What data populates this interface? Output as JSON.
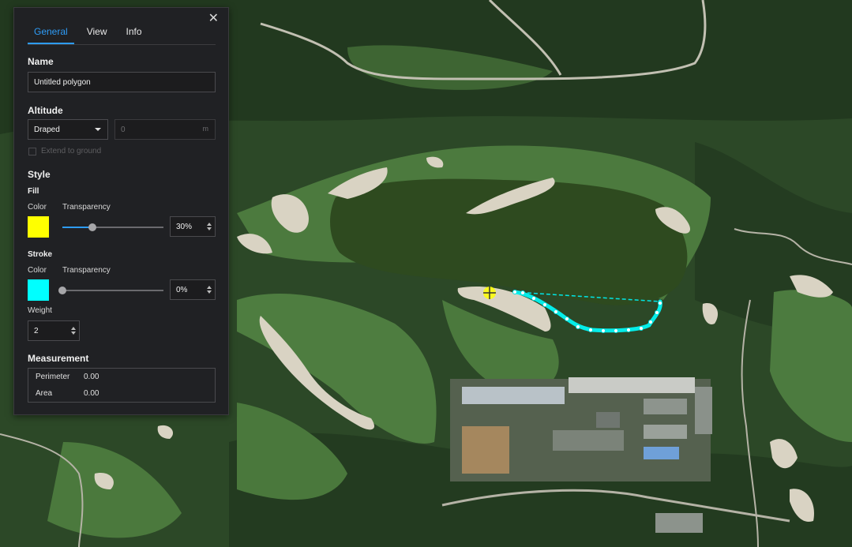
{
  "panel": {
    "close_symbol": "✕",
    "tabs": [
      {
        "label": "General",
        "active": true
      },
      {
        "label": "View",
        "active": false
      },
      {
        "label": "Info",
        "active": false
      }
    ],
    "name": {
      "heading": "Name",
      "value": "Untitled polygon"
    },
    "altitude": {
      "heading": "Altitude",
      "mode": "Draped",
      "value_placeholder": "0",
      "unit": "m",
      "extend_label": "Extend to ground",
      "extend_checked": false
    },
    "style": {
      "heading": "Style",
      "fill": {
        "heading": "Fill",
        "color_label": "Color",
        "transparency_label": "Transparency",
        "color": "#ffff00",
        "transparency": 30,
        "transparency_text": "30%"
      },
      "stroke": {
        "heading": "Stroke",
        "color_label": "Color",
        "transparency_label": "Transparency",
        "color": "#00ffff",
        "transparency": 0,
        "transparency_text": "0%"
      },
      "weight_label": "Weight",
      "weight": "2"
    },
    "measurement": {
      "heading": "Measurement",
      "perimeter_label": "Perimeter",
      "perimeter": "0.00",
      "area_label": "Area",
      "area": "0.00"
    }
  },
  "map": {
    "drawing_color": "#00ffff",
    "cursor_color": "#ffff00"
  }
}
